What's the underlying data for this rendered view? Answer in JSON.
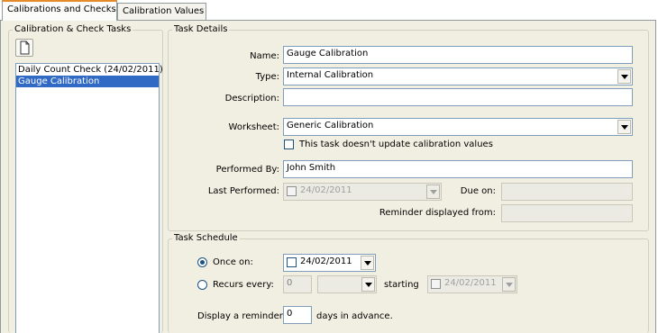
{
  "tabs": [
    {
      "label": "Calibrations and Checks"
    },
    {
      "label": "Calibration Values"
    }
  ],
  "tasks_group": {
    "title": "Calibration & Check Tasks",
    "new_icon": "new-document-icon",
    "items": [
      {
        "label": "Daily Count Check (24/02/2011)"
      },
      {
        "label": "Gauge Calibration"
      }
    ],
    "selected_index": 1
  },
  "details": {
    "title": "Task Details",
    "name_label": "Name:",
    "name_value": "Gauge Calibration",
    "type_label": "Type:",
    "type_value": "Internal Calibration",
    "description_label": "Description:",
    "description_value": "",
    "worksheet_label": "Worksheet:",
    "worksheet_value": "Generic Calibration",
    "no_update_label": "This task doesn't update calibration values",
    "no_update_checked": false,
    "performed_by_label": "Performed By:",
    "performed_by_value": "John Smith",
    "last_performed_label": "Last Performed:",
    "last_performed_value": "24/02/2011",
    "due_on_label": "Due on:",
    "due_on_value": "",
    "reminder_from_label": "Reminder displayed from:",
    "reminder_from_value": ""
  },
  "schedule": {
    "title": "Task Schedule",
    "once_label": "Once on:",
    "once_selected": true,
    "once_date": "24/02/2011",
    "recurs_label": "Recurs every:",
    "recurs_count": "0",
    "recurs_unit": "",
    "starting_label": "starting",
    "starting_date": "24/02/2011",
    "reminder_prefix": "Display a reminder",
    "reminder_days": "0",
    "reminder_suffix": "days in advance."
  }
}
